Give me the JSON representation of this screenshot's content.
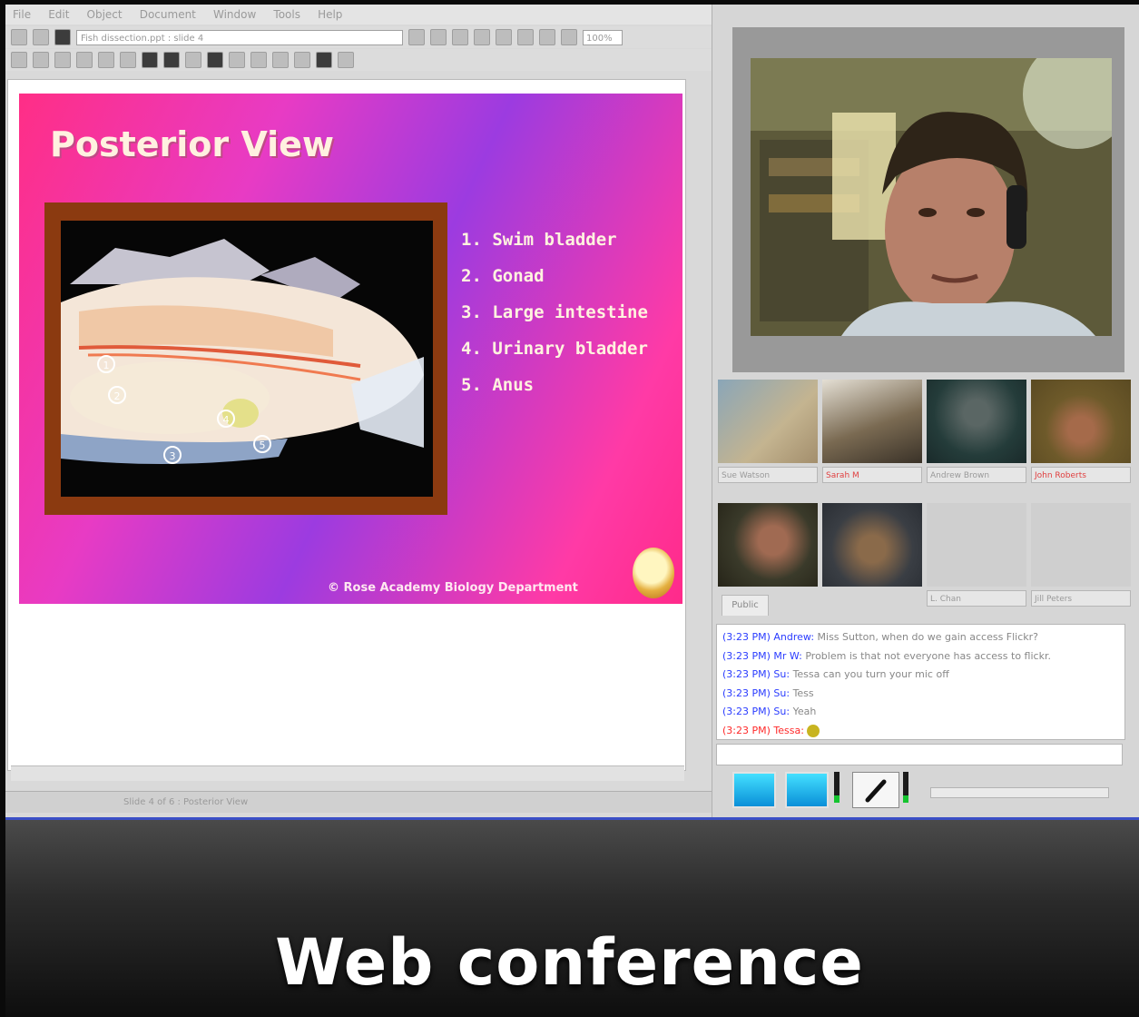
{
  "app": {
    "menu": [
      "File",
      "Edit",
      "Object",
      "Document",
      "Window",
      "Tools",
      "Help"
    ],
    "file_field": "Fish dissection.ppt : slide 4",
    "zoom": "100%",
    "status_text": "Slide 4 of 6 : Posterior View"
  },
  "slide": {
    "title": "Posterior View",
    "organs": [
      "1.  Swim bladder",
      "2.  Gonad",
      "3.  Large intestine",
      "4.  Urinary bladder",
      "5.  Anus"
    ],
    "footer": "© Rose Academy Biology Department"
  },
  "photo_markers": [
    "1",
    "2",
    "3",
    "4",
    "5"
  ],
  "participants": [
    {
      "name": "Sue Watson",
      "highlight": false
    },
    {
      "name": "Sarah M",
      "highlight": true
    },
    {
      "name": "Andrew Brown",
      "highlight": false
    },
    {
      "name": "John Roberts",
      "highlight": true
    },
    {
      "name": "",
      "highlight": false
    },
    {
      "name": "",
      "highlight": false
    },
    {
      "name": "L. Chan",
      "highlight": false
    },
    {
      "name": "Jill Peters",
      "highlight": false
    }
  ],
  "chat": {
    "tab_label": "Public",
    "messages": [
      {
        "time": "(3:23 PM) Andrew:",
        "text": "Miss Sutton, when do we gain access Flickr?",
        "highlight": false
      },
      {
        "time": "(3:23 PM) Mr W:",
        "text": "Problem is that not everyone has access to flickr.",
        "highlight": false
      },
      {
        "time": "(3:23 PM) Su:",
        "text": "Tessa can you turn your mic off",
        "highlight": false
      },
      {
        "time": "(3:23 PM) Su:",
        "text": "Tess",
        "highlight": false
      },
      {
        "time": "(3:23 PM) Su:",
        "text": "Yeah",
        "highlight": false
      },
      {
        "time": "(3:23 PM) Tessa:",
        "text": "",
        "highlight": true
      }
    ]
  },
  "caption": "Web conference",
  "colors": {
    "slide_pink": "#ff2e86",
    "slide_purple": "#9c3be0",
    "frame_brown": "#8b3a10",
    "accent_blue": "#3b4fc6",
    "cam_button": "#1aa8ea",
    "mic_level": "#15c42f"
  },
  "icons": [
    "camera-icon",
    "speaker-icon",
    "microphone-icon",
    "volume-slider"
  ]
}
